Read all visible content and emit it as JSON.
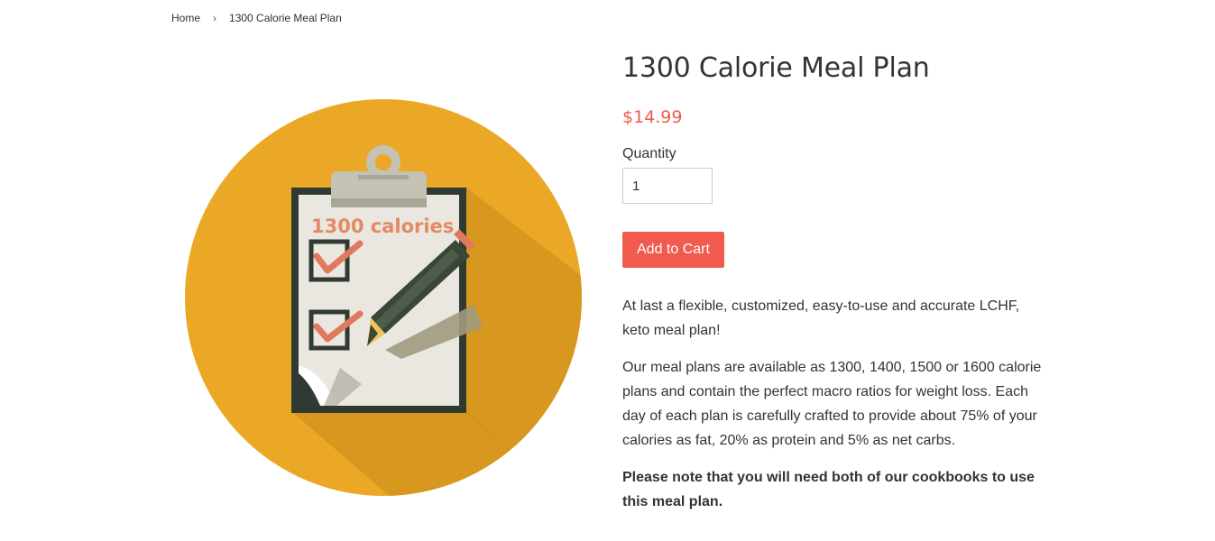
{
  "breadcrumb": {
    "home": "Home",
    "separator": "›",
    "current": "1300 Calorie Meal Plan"
  },
  "product": {
    "title": "1300 Calorie Meal Plan",
    "price": "$14.99",
    "quantity_label": "Quantity",
    "quantity_value": "1",
    "add_to_cart": "Add to Cart",
    "image_text": "1300 calories",
    "description": [
      "At last a flexible, customized, easy-to-use and accurate LCHF, keto meal plan!",
      "Our meal plans are available as 1300, 1400, 1500 or 1600 calorie plans and contain the perfect macro ratios for weight loss. Each day of each plan is carefully crafted to provide about 75% of your calories as fat, 20% as protein and 5% as net carbs.",
      "Please note that you will need both of our cookbooks to use this meal plan."
    ]
  },
  "colors": {
    "price": "#f15a49",
    "button": "#f15a4f",
    "circle": "#eba726",
    "clipboard_frame": "#2f3b32",
    "paper": "#e9e7e0",
    "check": "#e07a5f"
  }
}
